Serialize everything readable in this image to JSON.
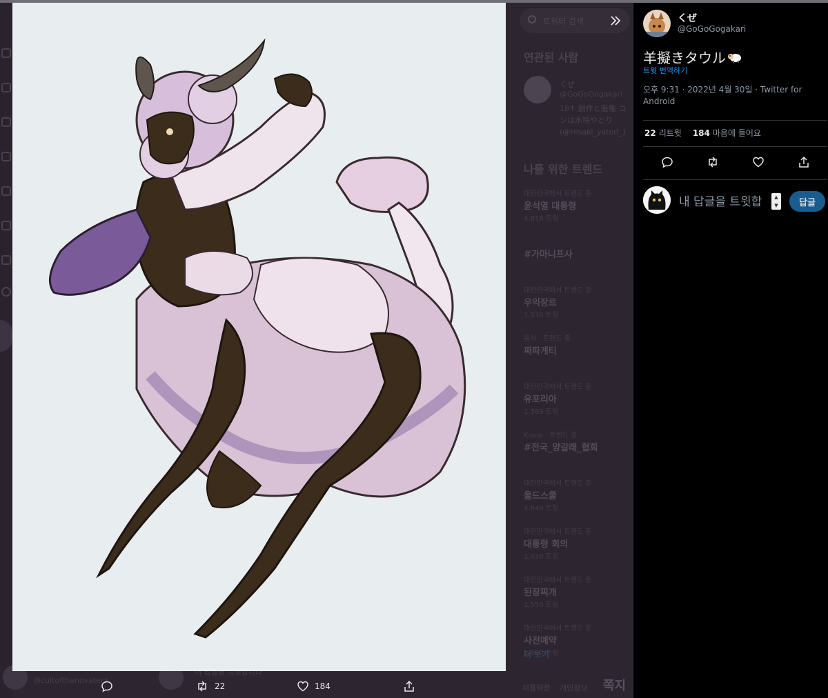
{
  "background_sidebar": {
    "search_placeholder": "트위터 검색",
    "relevant_people_title": "연관된 사람",
    "related_user": {
      "name": "くぜ",
      "handle": "@GoGoGogakari",
      "bio": "18↑ 創作と版権 コシは水咲やとり (@Hisaki_yatori_)"
    },
    "trends_title": "나를 위한 트렌드",
    "trends": [
      {
        "meta": "대한민국에서 트렌드 중",
        "title": "윤석열 대통령",
        "count": "4,818 트윗"
      },
      {
        "meta": "",
        "title": "#가마니프사",
        "count": ""
      },
      {
        "meta": "대한민국에서 트렌드 중",
        "title": "우익장르",
        "count": "1,536 트윗"
      },
      {
        "meta": "음식 · 트렌드 중",
        "title": "짜파게티",
        "count": ""
      },
      {
        "meta": "대한민국에서 트렌드 중",
        "title": "유포리아",
        "count": "1,369 트윗"
      },
      {
        "meta": "K-pop · 트렌드 중",
        "title": "#전국_양갈래_협회",
        "count": ""
      },
      {
        "meta": "대한민국에서 트렌드 중",
        "title": "올드스쿨",
        "count": "4,849 트윗"
      },
      {
        "meta": "대한민국에서 트렌드 중",
        "title": "대통령 회의",
        "count": "1,410 트윗"
      },
      {
        "meta": "대한민국에서 트렌드 중",
        "title": "된장찌개",
        "count": "1,550 트윗"
      },
      {
        "meta": "대한민국에서 트렌드 중",
        "title": "사전예약",
        "count": "1,990 트윗"
      }
    ],
    "show_more": "더 보기",
    "bottom_links": [
      "이용약관",
      "개인정보"
    ],
    "dm_label": "쪽지",
    "bottom_handle": "@cultofthenovaterz",
    "bottom_reply_hint": "내 답글을 트윗합니다"
  },
  "media": {
    "image_alt": "illustration",
    "actions": {
      "reply_count": "",
      "retweet_count": "22",
      "like_count": "184"
    }
  },
  "tweet": {
    "author_name": "くぜ",
    "author_handle": "@GoGoGogakari",
    "text": "羊擬きタウル",
    "text_emoji": "sheep-emoji",
    "translate_label": "트윗 번역하기",
    "meta": "오후 9:31 · 2022년 4월 30일 · Twitter for Android",
    "retweets_count": "22",
    "retweets_label": "리트윗",
    "likes_count": "184",
    "likes_label": "마음에 들어요"
  },
  "reply": {
    "placeholder": "내 답글을 트윗합",
    "button_label": "답글"
  },
  "colors": {
    "accent": "#1d9bf0",
    "reply_button": "#1a5c8e",
    "backdrop": "#2d2630",
    "image_bg": "#e8eeef"
  }
}
